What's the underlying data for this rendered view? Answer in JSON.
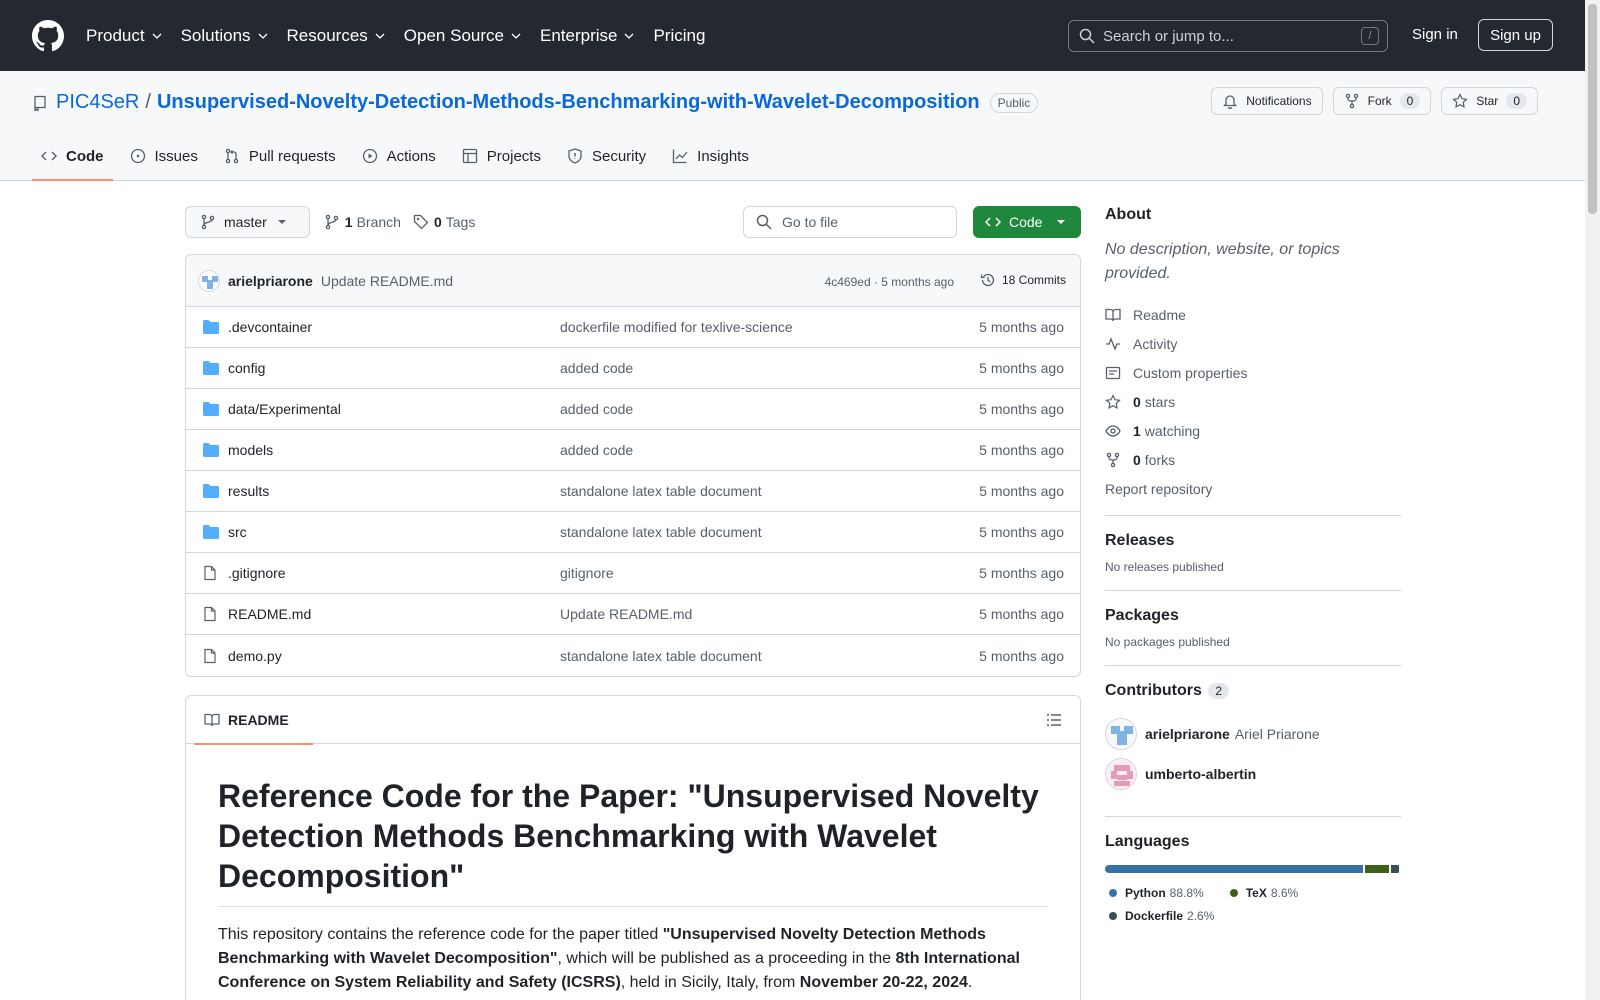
{
  "header": {
    "nav": [
      "Product",
      "Solutions",
      "Resources",
      "Open Source",
      "Enterprise",
      "Pricing"
    ],
    "search_placeholder": "Search or jump to...",
    "search_shortcut": "/",
    "sign_in": "Sign in",
    "sign_up": "Sign up"
  },
  "repo": {
    "owner": "PIC4SeR",
    "name": "Unsupervised-Novelty-Detection-Methods-Benchmarking-with-Wavelet-Decomposition",
    "visibility": "Public",
    "notifications_label": "Notifications",
    "fork_label": "Fork",
    "fork_count": "0",
    "star_label": "Star",
    "star_count": "0",
    "tabs": [
      "Code",
      "Issues",
      "Pull requests",
      "Actions",
      "Projects",
      "Security",
      "Insights"
    ]
  },
  "toolbar": {
    "branch": "master",
    "branch_count": "1",
    "branch_label": "Branch",
    "tag_count": "0",
    "tag_label": "Tags",
    "go_to_file": "Go to file",
    "code_label": "Code"
  },
  "commit": {
    "author": "arielpriarone",
    "message": "Update README.md",
    "meta": "4c469ed · 5 months ago",
    "count": "18 Commits"
  },
  "files": [
    {
      "name": ".devcontainer",
      "type": "dir",
      "message": "dockerfile modified for texlive-science",
      "date": "5 months ago"
    },
    {
      "name": "config",
      "type": "dir",
      "message": "added code",
      "date": "5 months ago"
    },
    {
      "name": "data/Experimental",
      "type": "dir",
      "message": "added code",
      "date": "5 months ago"
    },
    {
      "name": "models",
      "type": "dir",
      "message": "added code",
      "date": "5 months ago"
    },
    {
      "name": "results",
      "type": "dir",
      "message": "standalone latex table document",
      "date": "5 months ago"
    },
    {
      "name": "src",
      "type": "dir",
      "message": "standalone latex table document",
      "date": "5 months ago"
    },
    {
      "name": ".gitignore",
      "type": "file",
      "message": "gitignore",
      "date": "5 months ago"
    },
    {
      "name": "README.md",
      "type": "file",
      "message": "Update README.md",
      "date": "5 months ago"
    },
    {
      "name": "demo.py",
      "type": "file",
      "message": "standalone latex table document",
      "date": "5 months ago"
    }
  ],
  "readme": {
    "tab": "README",
    "title": "Reference Code for the Paper: \"Unsupervised Novelty Detection Methods Benchmarking with Wavelet Decomposition\"",
    "p1": "This repository contains the reference code for the paper titled ",
    "p1_bold": "\"Unsupervised Novelty Detection Methods Benchmarking with Wavelet Decomposition\"",
    "p2": ", which will be published as a proceeding in the ",
    "p2_bold": "8th International Conference on System Reliability and Safety (ICSRS)",
    "p3": ", held in Sicily, Italy, from ",
    "p3_bold": "November 20-22, 2024",
    "p4": "."
  },
  "about": {
    "title": "About",
    "description": "No description, website, or topics provided.",
    "links": [
      {
        "icon": "book-icon",
        "label": "Readme",
        "count": ""
      },
      {
        "icon": "pulse-icon",
        "label": "Activity",
        "count": ""
      },
      {
        "icon": "note-icon",
        "label": "Custom properties",
        "count": ""
      },
      {
        "icon": "star-icon",
        "label": "stars",
        "count": "0"
      },
      {
        "icon": "eye-icon",
        "label": "watching",
        "count": "1"
      },
      {
        "icon": "fork-icon",
        "label": "forks",
        "count": "0"
      }
    ],
    "report": "Report repository"
  },
  "releases": {
    "title": "Releases",
    "note": "No releases published"
  },
  "packages": {
    "title": "Packages",
    "note": "No packages published"
  },
  "contributors": {
    "title": "Contributors",
    "count": "2",
    "people": [
      {
        "login": "arielpriarone",
        "name": "Ariel Priarone"
      },
      {
        "login": "umberto-albertin",
        "name": ""
      }
    ]
  },
  "languages": {
    "title": "Languages",
    "items": [
      {
        "name": "Python",
        "percent": "88.8%",
        "value": 88.8,
        "color": "#3572A5"
      },
      {
        "name": "TeX",
        "percent": "8.6%",
        "value": 8.6,
        "color": "#3D6117"
      },
      {
        "name": "Dockerfile",
        "percent": "2.6%",
        "value": 2.6,
        "color": "#384d54"
      }
    ]
  }
}
